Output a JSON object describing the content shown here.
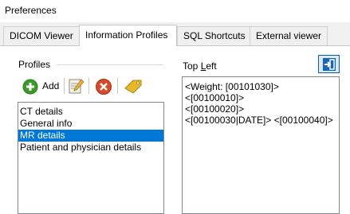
{
  "window": {
    "title": "Preferences"
  },
  "tabs": [
    {
      "label": "DICOM Viewer"
    },
    {
      "label": "Information Profiles"
    },
    {
      "label": "SQL Shortcuts"
    },
    {
      "label": "External viewer"
    }
  ],
  "profiles": {
    "group_label": "Profiles",
    "toolbar": {
      "add_label": "Add",
      "icons": [
        "add-icon",
        "edit-icon",
        "delete-icon",
        "tag-icon"
      ]
    },
    "items": [
      {
        "label": "CT details",
        "selected": false
      },
      {
        "label": "General info",
        "selected": false
      },
      {
        "label": "MR details",
        "selected": true
      },
      {
        "label": "Patient and physician details",
        "selected": false
      }
    ]
  },
  "position": {
    "label_prefix": "Top ",
    "label_underlined": "L",
    "label_suffix": "eft"
  },
  "editor": {
    "lines": [
      "<Weight: [00101030]>",
      "<[00100010]>",
      "<[00100020]>",
      "<[00100030|DATE]> <[00100040]>"
    ]
  },
  "colors": {
    "selection": "#0078d7",
    "add_icon": "#3a9a2a",
    "delete_icon": "#d44a2a",
    "tag_icon": "#d8a818",
    "arrange_button": "#1565b8"
  }
}
